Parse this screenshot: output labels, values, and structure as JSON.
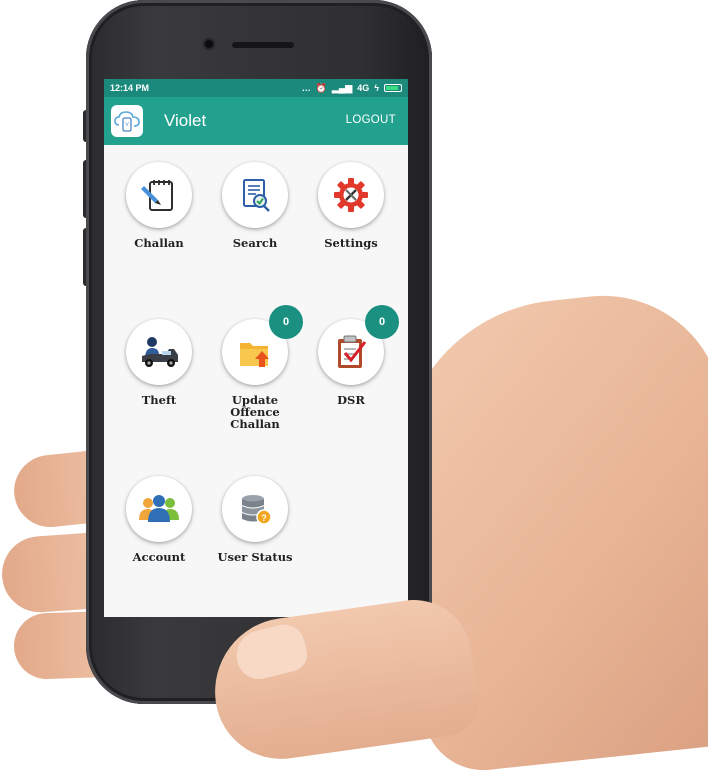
{
  "status_bar": {
    "time": "12:14 PM",
    "network": "4G"
  },
  "app_bar": {
    "title": "Violet",
    "logout_label": "LOGOUT"
  },
  "menu": {
    "items": [
      {
        "label": "Challan",
        "icon": "challan-pen-icon"
      },
      {
        "label": "Search",
        "icon": "search-document-icon"
      },
      {
        "label": "Settings",
        "icon": "settings-tools-icon"
      },
      {
        "label": "Theft",
        "icon": "theft-car-icon",
        "badge": null
      },
      {
        "label": "Update Offence\nChallan",
        "icon": "update-folder-icon",
        "badge": "0"
      },
      {
        "label": "DSR",
        "icon": "dsr-clipboard-icon",
        "badge": "0"
      },
      {
        "label": "Account",
        "icon": "account-users-icon"
      },
      {
        "label": "User Status",
        "icon": "user-status-database-icon"
      }
    ]
  },
  "colors": {
    "status_bar": "#1b8a7d",
    "app_bar": "#22a18f",
    "badge": "#1b8f80"
  }
}
